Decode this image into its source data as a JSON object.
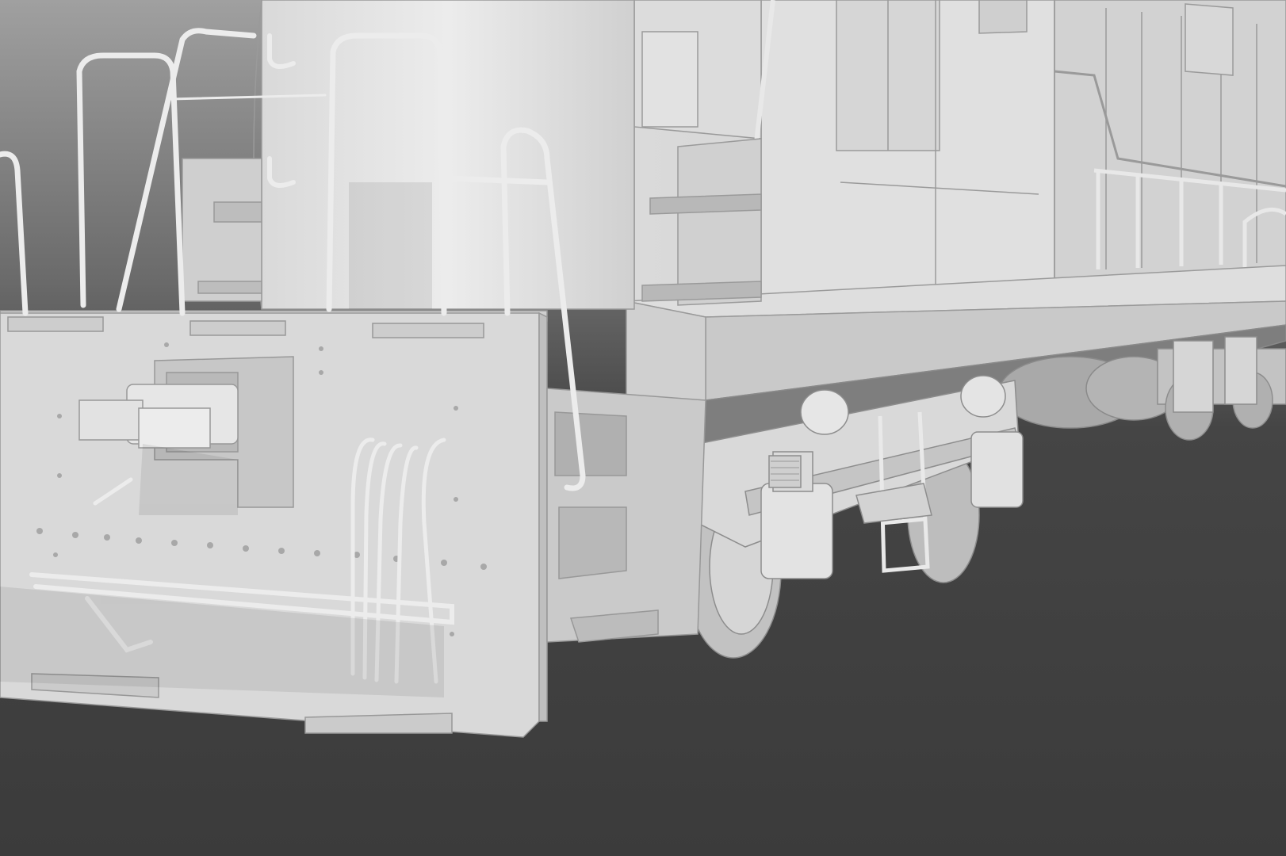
{
  "viewport": {
    "render_mode": "clay-shaded",
    "subject": "locomotive-front-corner"
  },
  "colors": {
    "background_top": "#9c9c9c",
    "background_mid": "#5e5e5e",
    "background_bottom": "#3c3c3c",
    "body_light": "#e4e4e4",
    "body_face": "#d8d8d8",
    "body_mid": "#c4c4c4",
    "body_shadow": "#a9a9a9",
    "underside": "#7d7d7d",
    "line": "#8f8f8f"
  }
}
